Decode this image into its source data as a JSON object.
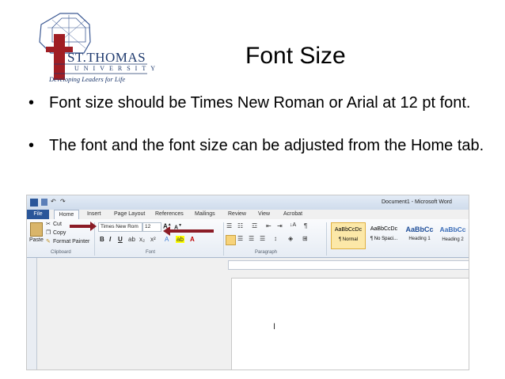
{
  "logo": {
    "name": "ST.THOMAS",
    "sub": "UNIVERSITY",
    "tagline": "Developing Leaders for Life"
  },
  "slide": {
    "title": "Font Size",
    "bullets": [
      "Font size should be Times New Roman or Arial at 12 pt font.",
      "The font and the font size can be adjusted from the Home tab."
    ]
  },
  "word": {
    "window_title": "Document1 - Microsoft Word",
    "tabs": [
      "File",
      "Home",
      "Insert",
      "Page Layout",
      "References",
      "Mailings",
      "Review",
      "View",
      "Acrobat"
    ],
    "active_tab": "Home",
    "clipboard": {
      "paste": "Paste",
      "cut": "Cut",
      "copy": "Copy",
      "format_painter": "Format Painter",
      "group_label": "Clipboard"
    },
    "font": {
      "font_name": "Times New Rom",
      "font_size": "12",
      "group_label": "Font",
      "bold": "B",
      "italic": "I",
      "underline": "U"
    },
    "paragraph": {
      "group_label": "Paragraph"
    },
    "styles": [
      {
        "preview": "AaBbCcDc",
        "name": "¶ Normal"
      },
      {
        "preview": "AaBbCcDc",
        "name": "¶ No Spaci..."
      },
      {
        "preview": "AaBbCc",
        "name": "Heading 1"
      },
      {
        "preview": "AaBbCc",
        "name": "Heading 2"
      }
    ],
    "cursor": "I",
    "colors": {
      "file_tab": "#2a5699",
      "arrow": "#8b1c26",
      "logo_red": "#a01e24",
      "logo_blue": "#1f3a6e"
    }
  }
}
